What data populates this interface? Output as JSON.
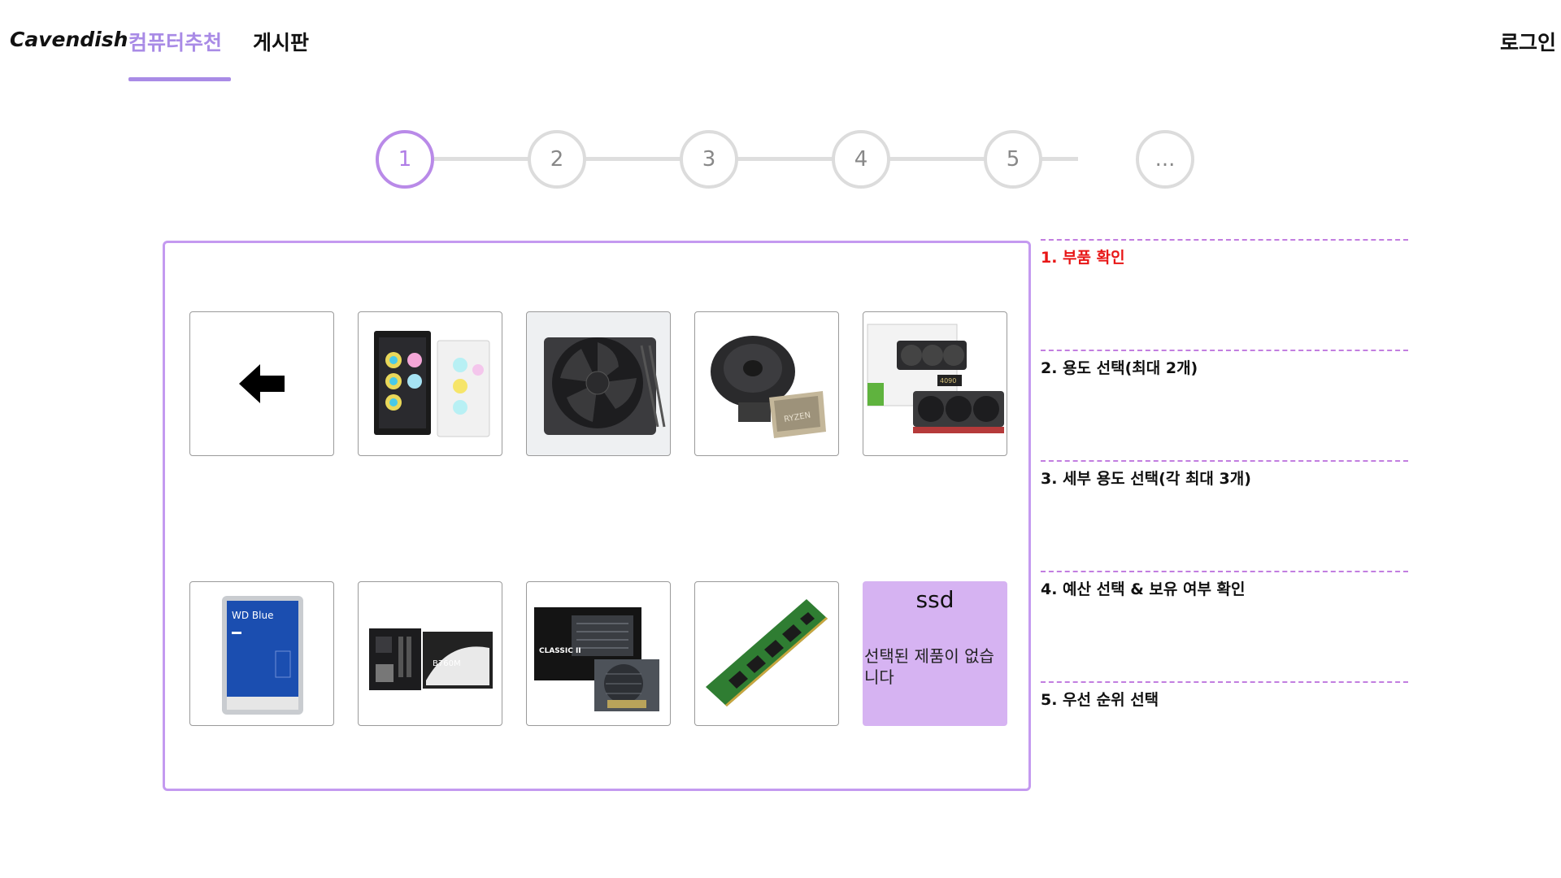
{
  "header": {
    "brand": "Cavendish",
    "nav": [
      {
        "label": "컴퓨터추천",
        "active": true
      },
      {
        "label": "게시판",
        "active": false
      }
    ],
    "login": "로그인",
    "accent_color": "#a98be6"
  },
  "stepper": {
    "current": 1,
    "steps": [
      "1",
      "2",
      "3",
      "4",
      "5",
      "..."
    ]
  },
  "parts": {
    "back_icon": "arrow-left-icon",
    "items": [
      {
        "name": "case",
        "icon": "pc-case-image"
      },
      {
        "name": "cooler",
        "icon": "cpu-cooler-image"
      },
      {
        "name": "cpu",
        "icon": "cpu-image"
      },
      {
        "name": "gpu",
        "icon": "gpu-image"
      },
      {
        "name": "hdd",
        "icon": "hdd-image",
        "text": "WD Blue"
      },
      {
        "name": "motherboard",
        "icon": "motherboard-image",
        "text": "B760M"
      },
      {
        "name": "psu",
        "icon": "psu-image",
        "text": "CLASSIC II"
      },
      {
        "name": "ram",
        "icon": "ram-image"
      }
    ],
    "selected": {
      "title": "ssd",
      "message": "선택된 제품이 없습니다",
      "color": "#d6b3f2"
    }
  },
  "side_steps": [
    {
      "label": "1. 부품 확인",
      "current": true
    },
    {
      "label": "2. 용도 선택(최대 2개)",
      "current": false
    },
    {
      "label": "3. 세부 용도 선택(각 최대 3개)",
      "current": false
    },
    {
      "label": "4. 예산 선택 & 보유 여부 확인",
      "current": false
    },
    {
      "label": "5. 우선 순위 선택",
      "current": false
    }
  ],
  "colors": {
    "panel_border": "#c49af0",
    "current_step_text": "#e81616",
    "dashed_line": "#c27ee0"
  }
}
